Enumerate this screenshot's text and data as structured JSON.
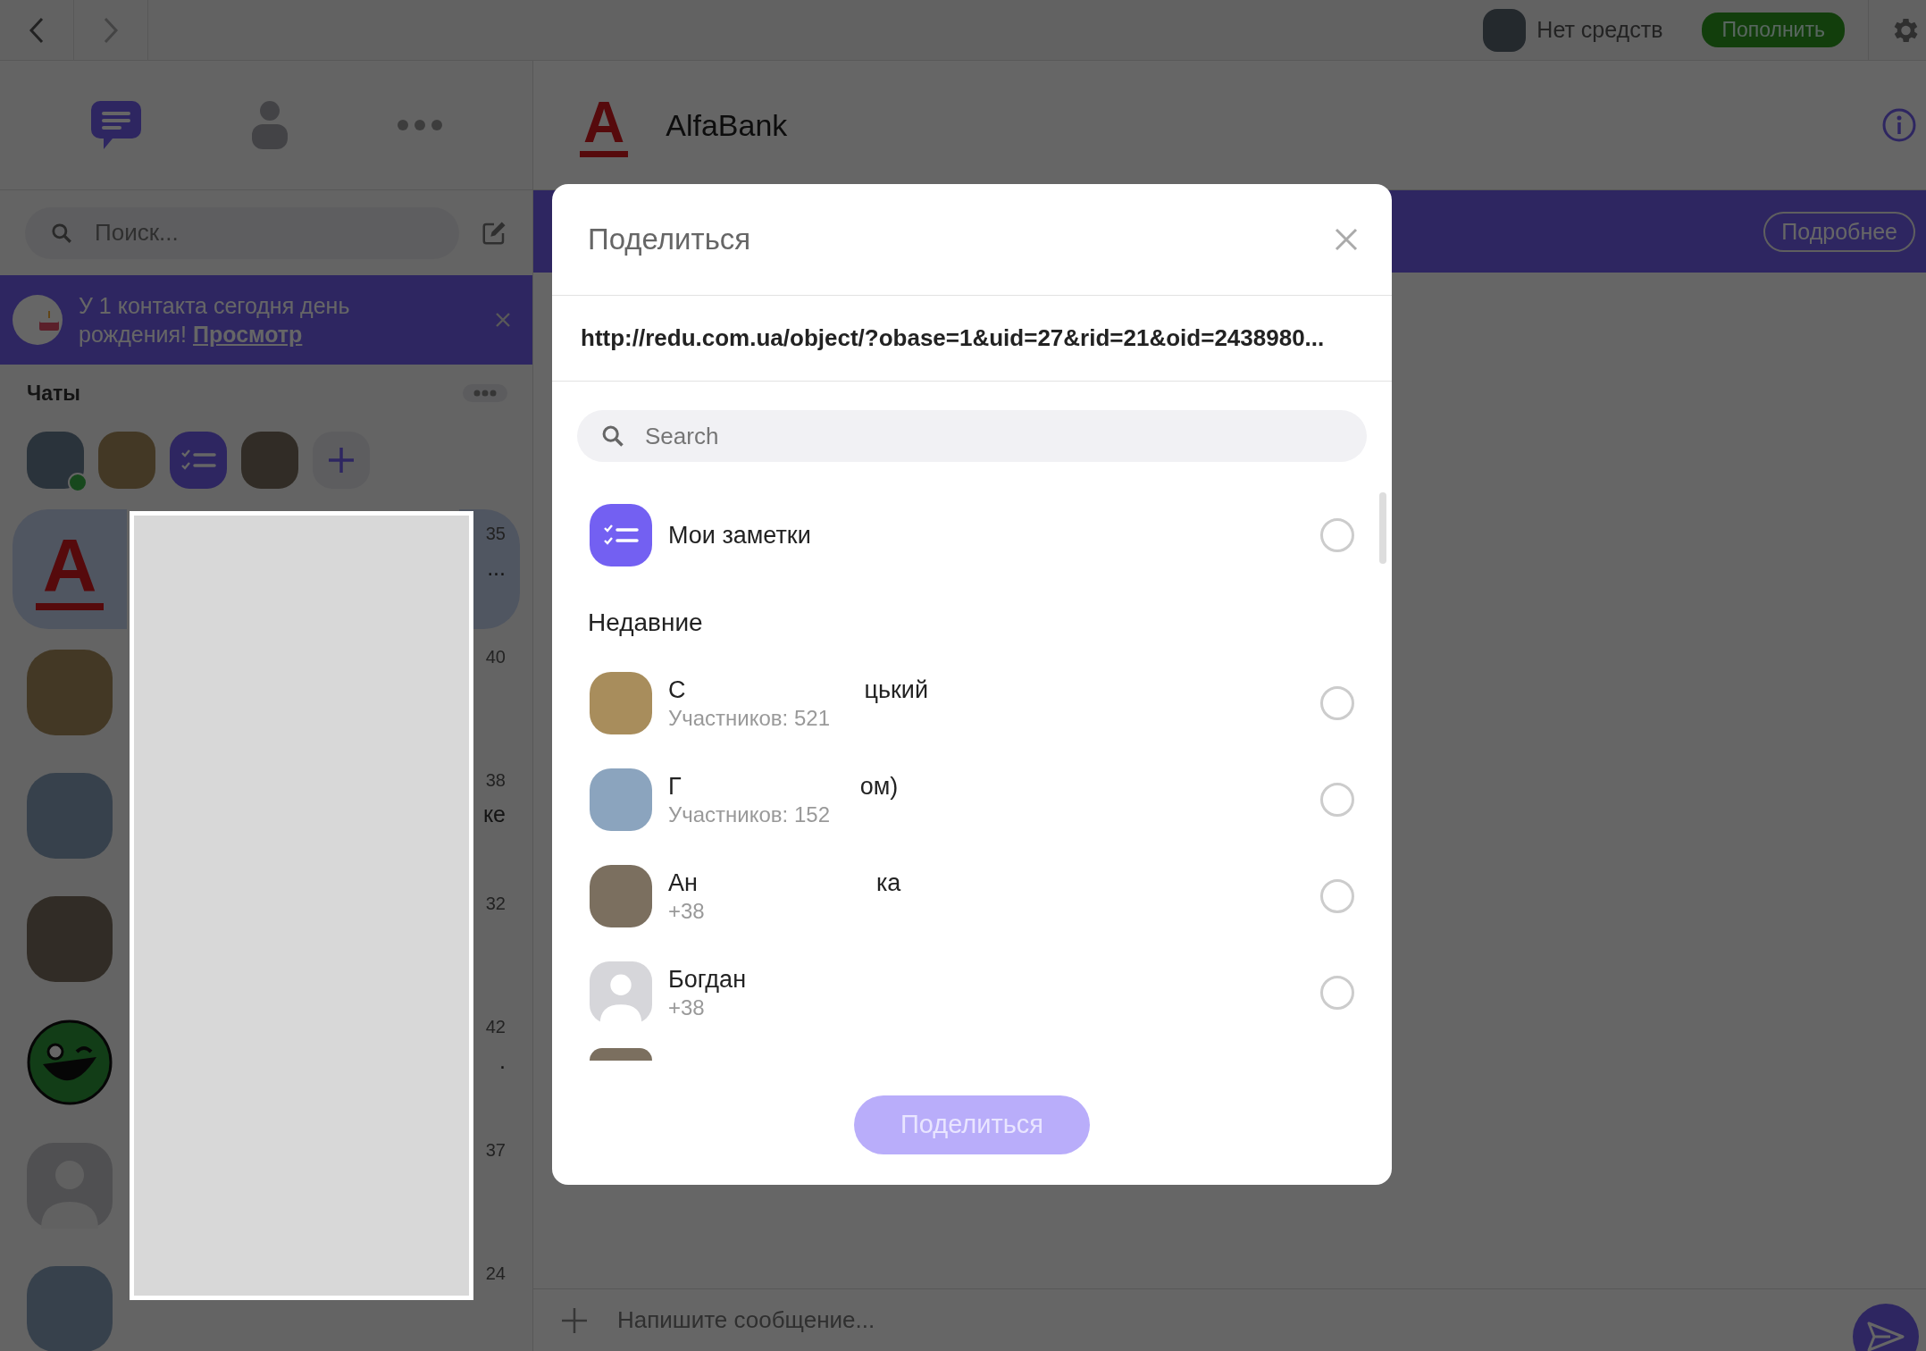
{
  "top_bar": {
    "balance": "Нет средств",
    "top_up": "Пополнить"
  },
  "sidebar": {
    "search": {
      "placeholder": "Поиск..."
    },
    "birthday": {
      "text": "У 1 контакта сегодня день рождения!",
      "link": "Просмотр"
    },
    "chats_label": "Чаты",
    "quick_avatars": [
      {
        "kind": "photo",
        "online": true
      },
      {
        "kind": "photo",
        "online": false
      },
      {
        "kind": "notes",
        "online": false
      },
      {
        "kind": "photo",
        "online": false
      }
    ],
    "chats": [
      {
        "kind": "logo",
        "logo": "A",
        "time": "35",
        "preview": "...",
        "selected": true
      },
      {
        "kind": "photo",
        "time": "40",
        "selected": false
      },
      {
        "kind": "photo",
        "time": "38",
        "preview": "ке",
        "selected": false
      },
      {
        "kind": "photo",
        "time": "32",
        "selected": false
      },
      {
        "kind": "smiley",
        "time": "42",
        "preview": ".",
        "selected": false
      },
      {
        "kind": "default",
        "time": "37",
        "selected": false
      },
      {
        "kind": "photo",
        "time": "24",
        "selected": false
      }
    ]
  },
  "chat": {
    "logo": "A",
    "title": "AlfaBank",
    "banner_button": "Подробнее",
    "composer": {
      "placeholder": "Напишите сообщение..."
    }
  },
  "modal": {
    "title": "Поделиться",
    "url": "http://redu.com.ua/object/?obase=1&uid=27&rid=21&oid=2438980...",
    "search": {
      "placeholder": "Search"
    },
    "notes": {
      "name": "Мои заметки",
      "selected": false
    },
    "recent_label": "Недавние",
    "recents": [
      {
        "kind": "photo",
        "name_parts": [
          "С",
          "цький"
        ],
        "subtitle": "Участников: 521",
        "selected": false
      },
      {
        "kind": "photo",
        "name_parts": [
          "Г",
          "ом)"
        ],
        "subtitle": "Участников: 152",
        "selected": false
      },
      {
        "kind": "photo",
        "name_parts": [
          "Ан",
          "ка"
        ],
        "subtitle": "+38",
        "selected": false
      },
      {
        "kind": "default",
        "name_parts": [
          "Богдан"
        ],
        "subtitle": "+38",
        "selected": false
      }
    ],
    "share_button": {
      "label": "Поделиться",
      "disabled": true
    }
  }
}
